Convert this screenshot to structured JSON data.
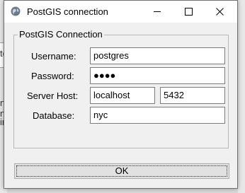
{
  "window": {
    "title": "PostGIS connection",
    "icon": "globe-icon"
  },
  "titlebar_buttons": {
    "minimize_icon": "minimize-icon",
    "maximize_icon": "maximize-icon",
    "close_icon": "close-icon"
  },
  "group": {
    "legend": "PostGIS Connection"
  },
  "form": {
    "username_label": "Username:",
    "username_value": "postgres",
    "password_label": "Password:",
    "password_value": "●●●●",
    "server_host_label": "Server Host:",
    "server_host_value": "localhost",
    "port_value": "5432",
    "database_label": "Database:",
    "database_value": "nyc"
  },
  "buttons": {
    "ok_label": "OK"
  },
  "background": {
    "fragments": [
      "te",
      "n",
      "n",
      "ir"
    ]
  }
}
